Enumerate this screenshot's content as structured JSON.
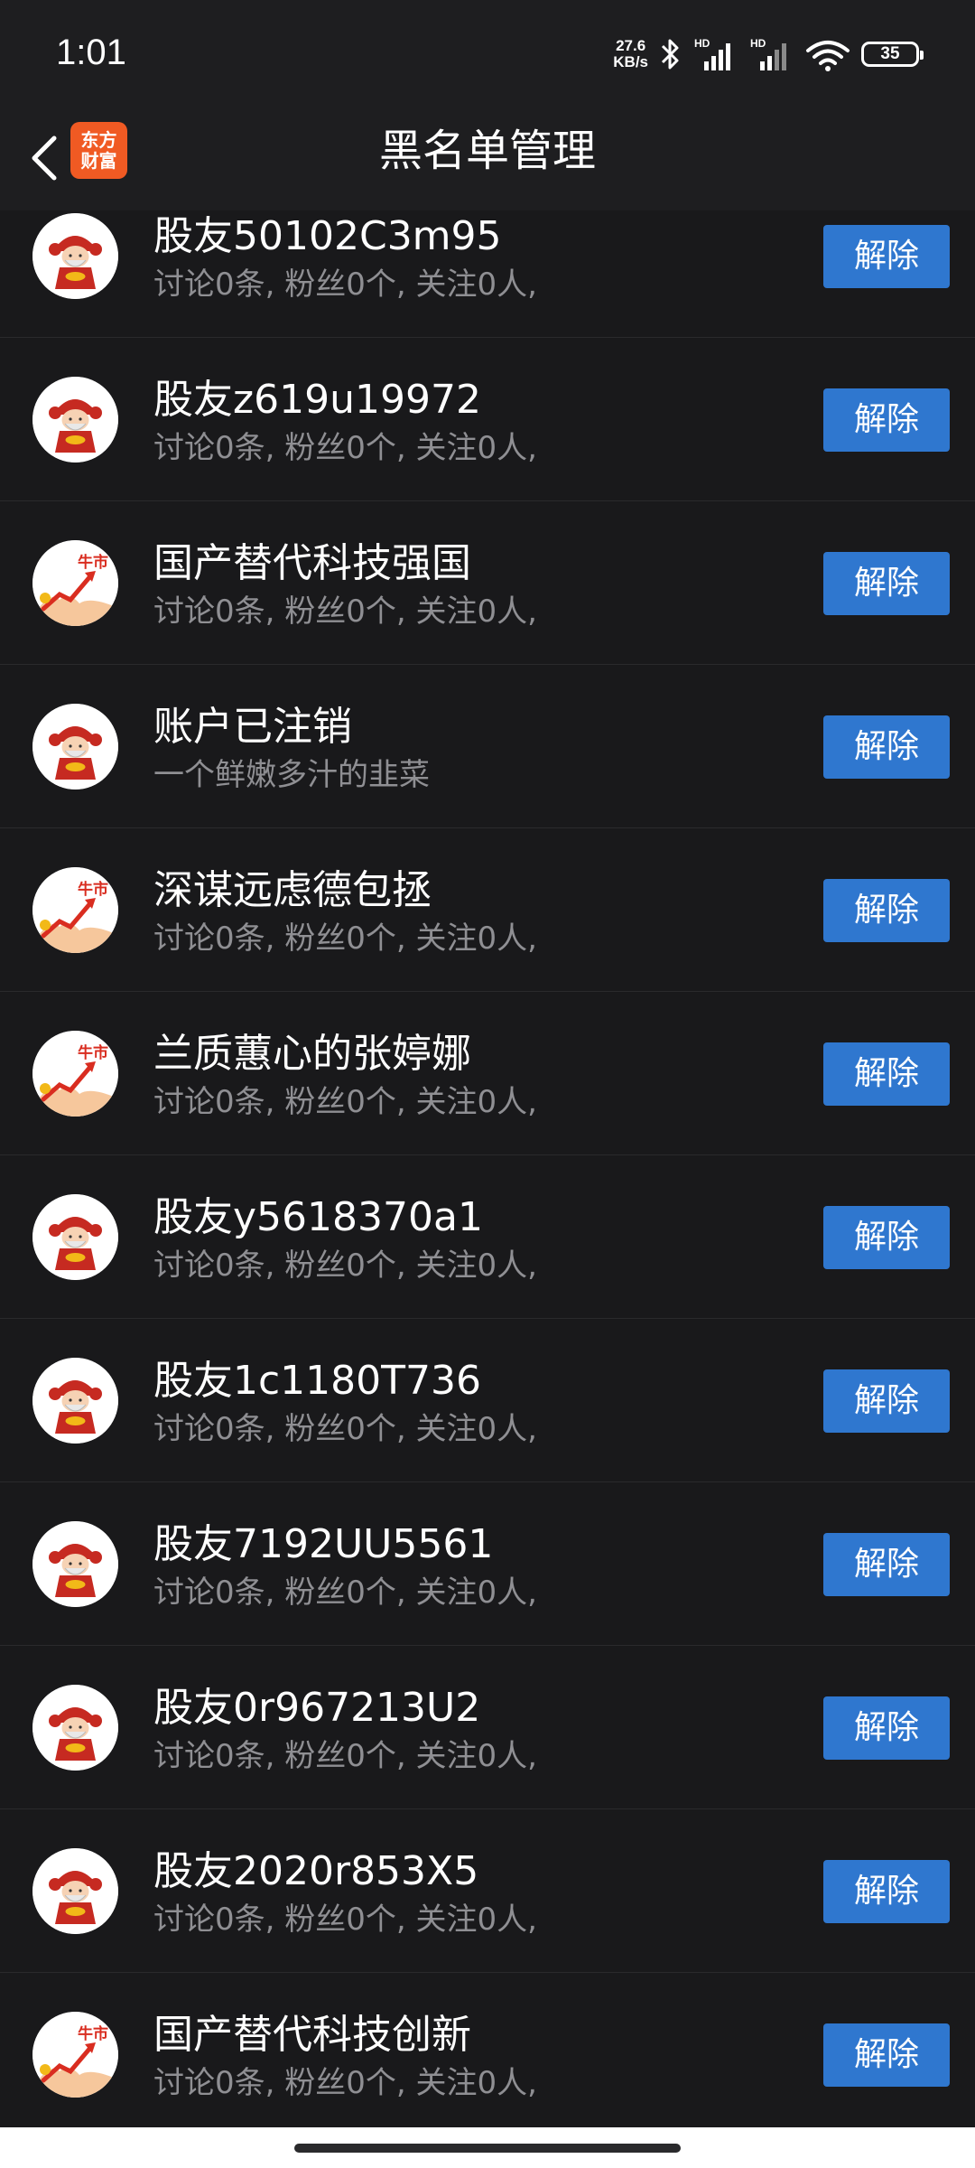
{
  "status_bar": {
    "time": "1:01",
    "net_speed_value": "27.6",
    "net_speed_unit": "KB/s",
    "battery": "35",
    "icons": [
      "bluetooth-icon",
      "signal-hd-icon",
      "signal-hd-icon",
      "wifi-icon",
      "battery-icon"
    ]
  },
  "header": {
    "title": "黑名单管理",
    "logo_line1": "东方",
    "logo_line2": "财富",
    "back_icon": "chevron-left-icon"
  },
  "colors": {
    "background": "#19191b",
    "button": "#2f77cf",
    "logo": "#f05a23",
    "secondary_text": "#8f8f93"
  },
  "blacklist": {
    "button_label": "解除",
    "items": [
      {
        "name": "股友50102C3m95",
        "stats": "讨论0条, 粉丝0个, 关注0人,",
        "avatar": "fortune-god-avatar"
      },
      {
        "name": "股友z619u19972",
        "stats": "讨论0条, 粉丝0个, 关注0人,",
        "avatar": "fortune-god-avatar"
      },
      {
        "name": "国产替代科技强国",
        "stats": "讨论0条, 粉丝0个, 关注0人,",
        "avatar": "bull-market-avatar"
      },
      {
        "name": "账户已注销",
        "stats": "一个鲜嫩多汁的韭菜",
        "avatar": "fortune-god-avatar"
      },
      {
        "name": "深谋远虑德包拯",
        "stats": "讨论0条, 粉丝0个, 关注0人,",
        "avatar": "bull-market-avatar"
      },
      {
        "name": "兰质蕙心的张婷娜",
        "stats": "讨论0条, 粉丝0个, 关注0人,",
        "avatar": "bull-market-avatar"
      },
      {
        "name": "股友y5618370a1",
        "stats": "讨论0条, 粉丝0个, 关注0人,",
        "avatar": "fortune-god-avatar"
      },
      {
        "name": "股友1c1180T736",
        "stats": "讨论0条, 粉丝0个, 关注0人,",
        "avatar": "fortune-god-avatar"
      },
      {
        "name": "股友7192UU5561",
        "stats": "讨论0条, 粉丝0个, 关注0人,",
        "avatar": "fortune-god-avatar"
      },
      {
        "name": "股友0r967213U2",
        "stats": "讨论0条, 粉丝0个, 关注0人,",
        "avatar": "fortune-god-avatar"
      },
      {
        "name": "股友2020r853X5",
        "stats": "讨论0条, 粉丝0个, 关注0人,",
        "avatar": "fortune-god-avatar"
      },
      {
        "name": "国产替代科技创新",
        "stats": "讨论0条, 粉丝0个, 关注0人,",
        "avatar": "bull-market-avatar"
      }
    ]
  }
}
